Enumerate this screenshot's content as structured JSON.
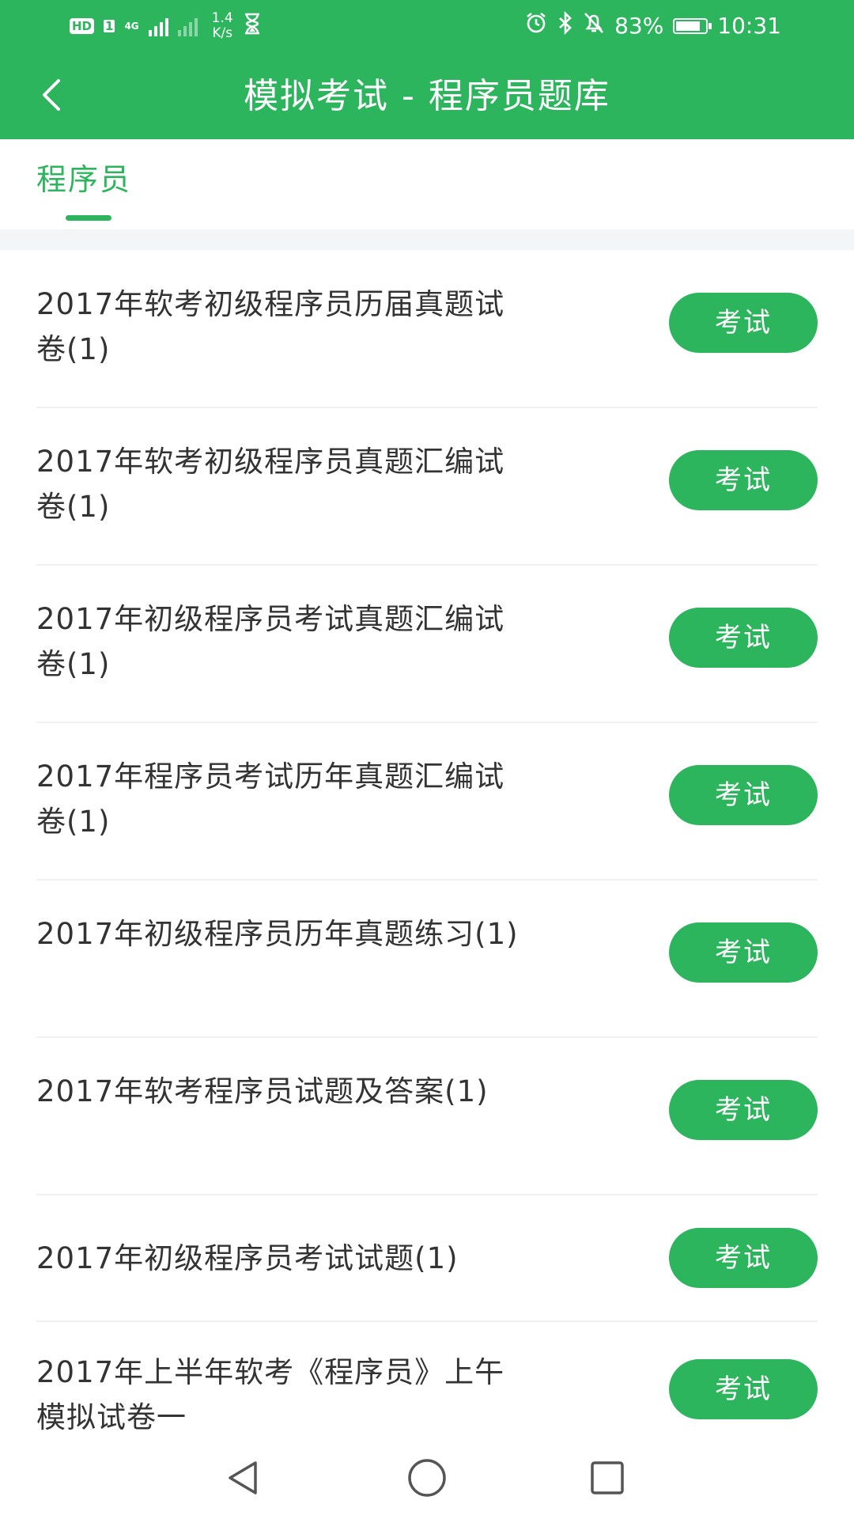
{
  "status_bar": {
    "hd": "HD",
    "sim": "1",
    "network_type": "4G",
    "net_speed_value": "1.4",
    "net_speed_unit": "K/s",
    "battery": "83%",
    "battery_level": 0.83,
    "time": "10:31"
  },
  "header": {
    "title": "模拟考试 - 程序员题库"
  },
  "tabs": [
    {
      "label": "程序员",
      "selected": true
    }
  ],
  "exam_list": [
    {
      "title": "2017年软考初级程序员历届真题试卷(1)",
      "button": "考试"
    },
    {
      "title": "2017年软考初级程序员真题汇编试卷(1)",
      "button": "考试"
    },
    {
      "title": "2017年初级程序员考试真题汇编试卷(1)",
      "button": "考试"
    },
    {
      "title": "2017年程序员考试历年真题汇编试卷(1)",
      "button": "考试"
    },
    {
      "title": "2017年初级程序员历年真题练习(1)",
      "button": "考试"
    },
    {
      "title": "2017年软考程序员试题及答案(1)",
      "button": "考试"
    },
    {
      "title": "2017年初级程序员考试试题(1)",
      "button": "考试"
    },
    {
      "title": "2017年上半年软考《程序员》上午模拟试卷一",
      "button": "考试"
    }
  ],
  "colors": {
    "primary": "#2db55d",
    "text": "#333333",
    "divider": "#eef0f2",
    "background_gap": "#f3f5f7"
  },
  "icons": {
    "back": "chevron-left-icon",
    "alarm": "alarm-clock-icon",
    "bluetooth": "bluetooth-icon",
    "mute": "bell-off-icon",
    "hourglass": "hourglass-icon",
    "nav_back": "triangle-back-icon",
    "nav_home": "circle-home-icon",
    "nav_recents": "square-recents-icon"
  }
}
